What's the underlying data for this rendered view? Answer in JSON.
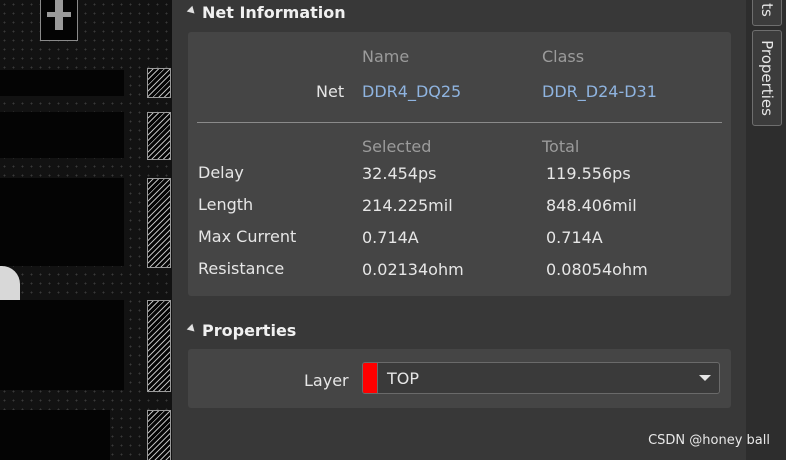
{
  "net_information": {
    "title": "Net Information",
    "col_name": "Name",
    "col_class": "Class",
    "net_label": "Net",
    "net_name": "DDR4_DQ25",
    "net_class": "DDR_D24-D31",
    "col_selected": "Selected",
    "col_total": "Total",
    "rows": [
      {
        "label": "Delay",
        "selected": "32.454ps",
        "total": "119.556ps"
      },
      {
        "label": "Length",
        "selected": "214.225mil",
        "total": "848.406mil"
      },
      {
        "label": "Max Current",
        "selected": "0.714A",
        "total": "0.714A"
      },
      {
        "label": "Resistance",
        "selected": "0.02134ohm",
        "total": "0.08054ohm"
      }
    ]
  },
  "properties": {
    "title": "Properties",
    "layer_label": "Layer",
    "layer_value": "TOP",
    "layer_color": "#ff0000"
  },
  "side_tabs": {
    "tab_top": "ts",
    "tab_properties": "Properties"
  },
  "watermark": "CSDN @honey ball",
  "colors": {
    "panel_bg": "#383838",
    "box_bg": "#454545",
    "link": "#8fb4e0"
  }
}
